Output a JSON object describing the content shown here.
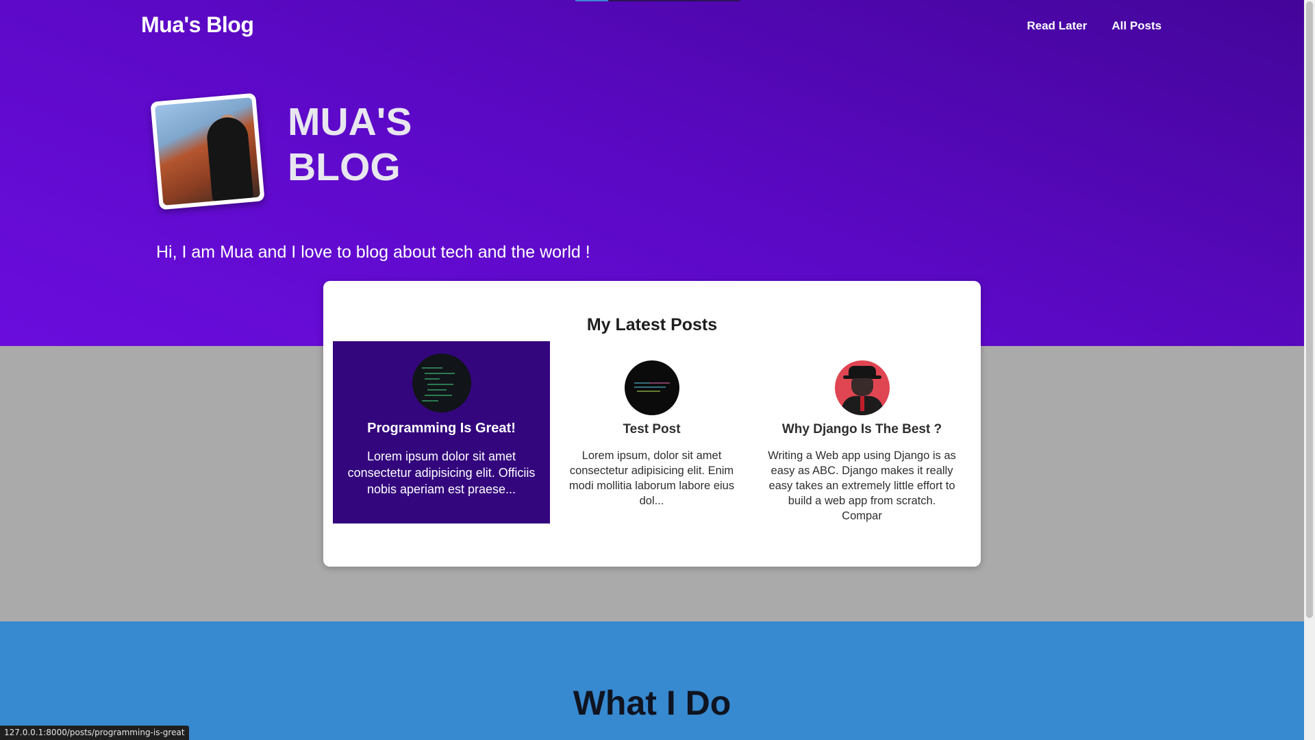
{
  "nav": {
    "brand": "Mua's Blog",
    "links": [
      "Read Later",
      "All Posts"
    ]
  },
  "hero": {
    "title_line1": "MUA'S",
    "title_line2": "BLOG",
    "tagline": "Hi, I am Mua and I love to blog about tech and the world !"
  },
  "latest_posts": {
    "heading": "My Latest Posts",
    "posts": [
      {
        "title": "Programming Is Great!",
        "excerpt": "Lorem ipsum dolor sit amet consectetur adipisicing elit. Officiis nobis aperiam est praese...",
        "thumbnail": "code-screen-image",
        "hovered": true
      },
      {
        "title": "Test Post",
        "excerpt": "Lorem ipsum, dolor sit amet consectetur adipisicing elit. Enim modi mollitia laborum labore eius dol...",
        "thumbnail": "dark-code-image"
      },
      {
        "title": "Why Django Is The Best ?",
        "excerpt": "Writing a Web app using Django is as easy as ABC. Django makes it really easy takes an extremely little effort to build a web app from scratch. Compar",
        "thumbnail": "gentleman-illustration-image"
      }
    ]
  },
  "what_i_do": {
    "heading": "What I Do"
  },
  "status_bar": {
    "url": "127.0.0.1:8000/posts/programming-is-great"
  },
  "colors": {
    "hero_gradient": [
      "#44059a",
      "#6a0ddd"
    ],
    "active_post": "#33067d",
    "section_blue": "#3789d0",
    "page_gray": "#aaaaaa"
  }
}
